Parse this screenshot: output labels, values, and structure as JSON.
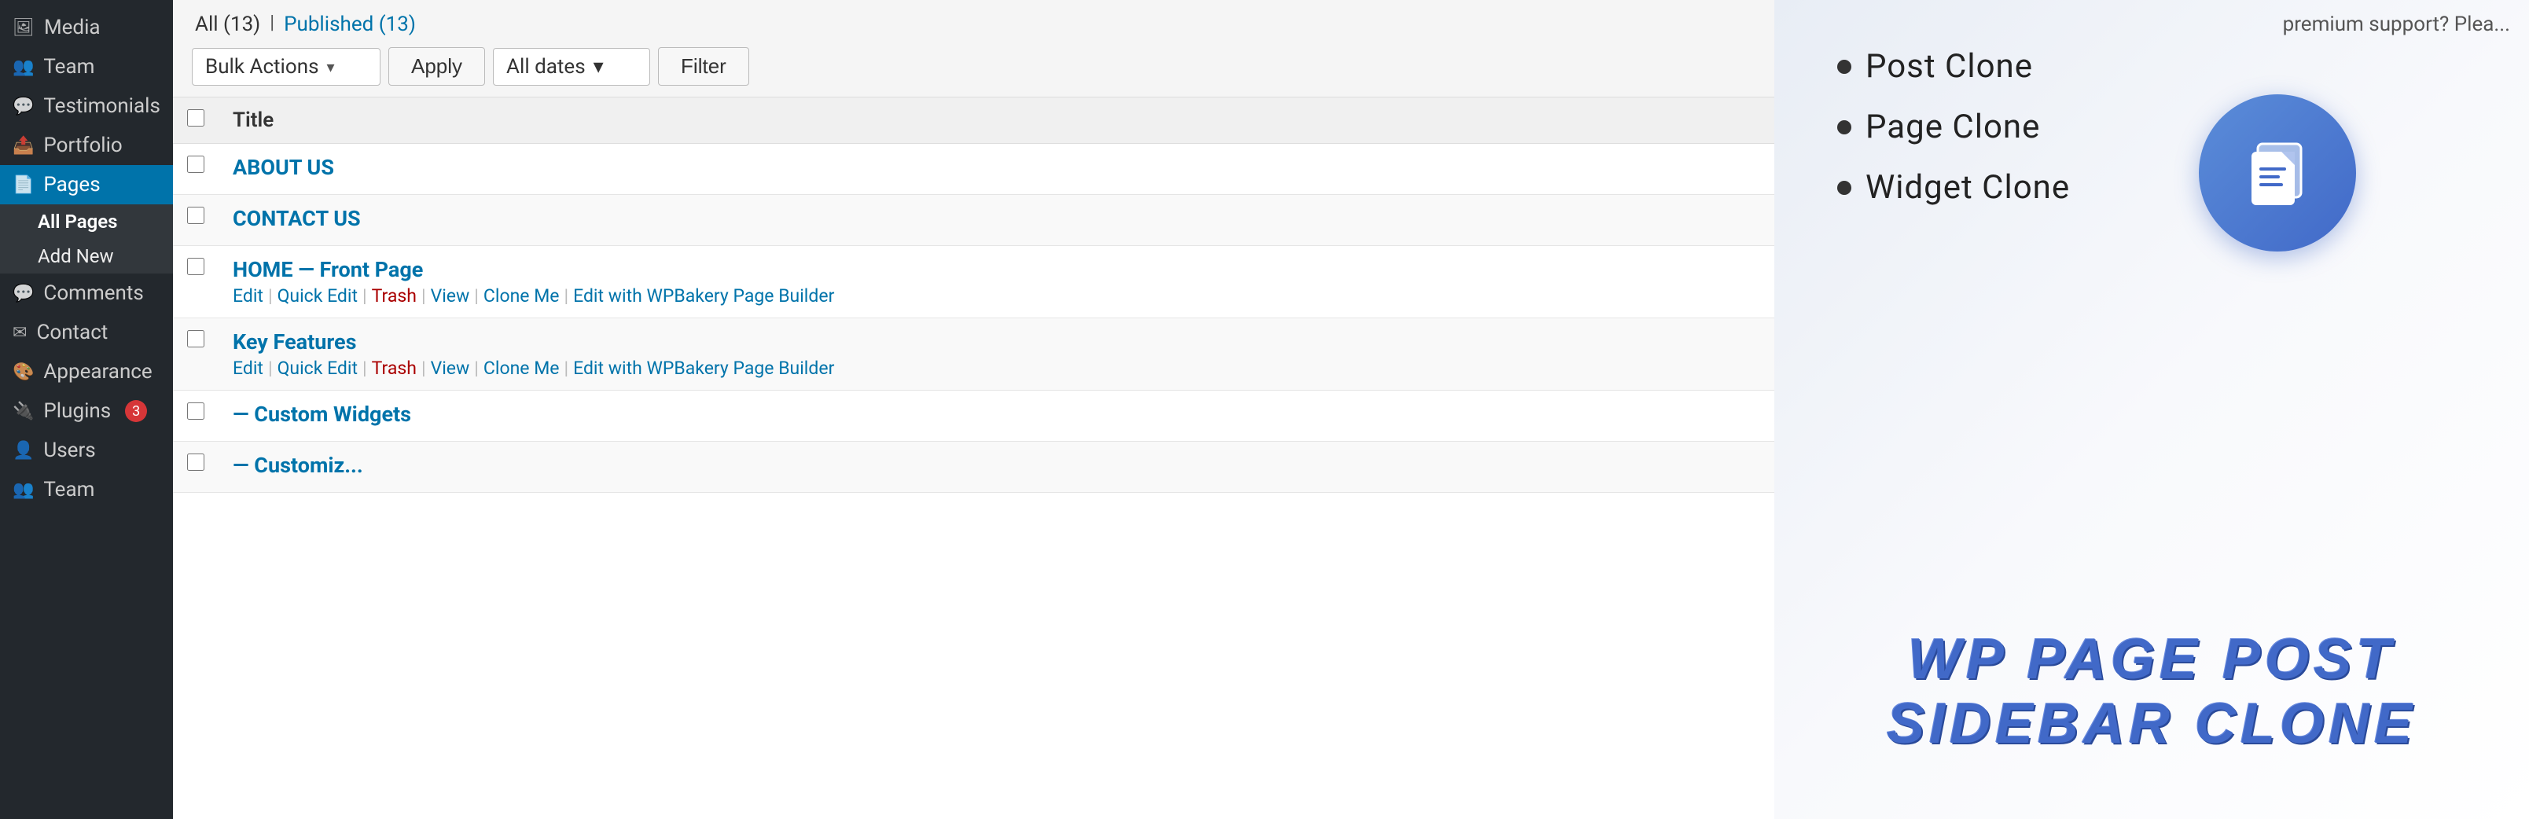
{
  "sidebar": {
    "items": [
      {
        "id": "media",
        "label": "Media",
        "icon": "🖼"
      },
      {
        "id": "team",
        "label": "Team",
        "icon": "👥"
      },
      {
        "id": "testimonials",
        "label": "Testimonials",
        "icon": "💬"
      },
      {
        "id": "portfolio",
        "label": "Portfolio",
        "icon": "📤"
      },
      {
        "id": "pages",
        "label": "Pages",
        "icon": "📄"
      }
    ],
    "sub_items": [
      {
        "id": "all-pages",
        "label": "All Pages",
        "active": true
      },
      {
        "id": "add-new",
        "label": "Add New",
        "active": false
      }
    ],
    "more_items": [
      {
        "id": "comments",
        "label": "Comments",
        "icon": "💬"
      },
      {
        "id": "contact",
        "label": "Contact",
        "icon": "✉"
      },
      {
        "id": "appearance",
        "label": "Appearance",
        "icon": "🎨"
      },
      {
        "id": "plugins",
        "label": "Plugins",
        "badge": "3",
        "icon": "🔌"
      },
      {
        "id": "users",
        "label": "Users",
        "icon": "👤"
      },
      {
        "id": "team2",
        "label": "Team",
        "icon": "👥"
      }
    ]
  },
  "header": {
    "filter_tabs": [
      {
        "id": "all",
        "label": "All (13)",
        "active": true
      },
      {
        "id": "published",
        "label": "Published (13)",
        "active": false
      }
    ],
    "separator": "|"
  },
  "toolbar": {
    "bulk_actions_label": "Bulk Actions",
    "bulk_actions_arrow": "▾",
    "apply_label": "Apply",
    "date_label": "All dates",
    "date_arrow": "▾",
    "filter_label": "Filter"
  },
  "table": {
    "columns": [
      {
        "id": "cb",
        "label": ""
      },
      {
        "id": "title",
        "label": "Title"
      }
    ],
    "rows": [
      {
        "id": 1,
        "title": "ABOUT US",
        "actions": [],
        "indent": 0
      },
      {
        "id": 2,
        "title": "CONTACT US",
        "actions": [],
        "indent": 0
      },
      {
        "id": 3,
        "title": "HOME — Front Page",
        "actions": [
          "Edit",
          "Quick Edit",
          "Trash",
          "View",
          "Clone Me",
          "Edit with WPBakery Page Builder"
        ],
        "indent": 0
      },
      {
        "id": 4,
        "title": "Key Features",
        "actions": [
          "Edit",
          "Quick Edit",
          "Trash",
          "View",
          "Clone Me",
          "Edit with WPBakery Page Builder"
        ],
        "indent": 0
      },
      {
        "id": 5,
        "title": "— Custom Widgets",
        "actions": [],
        "indent": 1
      },
      {
        "id": 6,
        "title": "— Customiz...",
        "actions": [],
        "indent": 1
      }
    ]
  },
  "right_panel": {
    "premium_notice": "premium support? Plea...",
    "features": [
      {
        "id": "post-clone",
        "label": "Post Clone"
      },
      {
        "id": "page-clone",
        "label": "Page Clone"
      },
      {
        "id": "widget-clone",
        "label": "Widget Clone"
      }
    ],
    "plugin_title": "WP Page Post Sidebar Clone",
    "clone_icon_alt": "clone documents icon"
  }
}
